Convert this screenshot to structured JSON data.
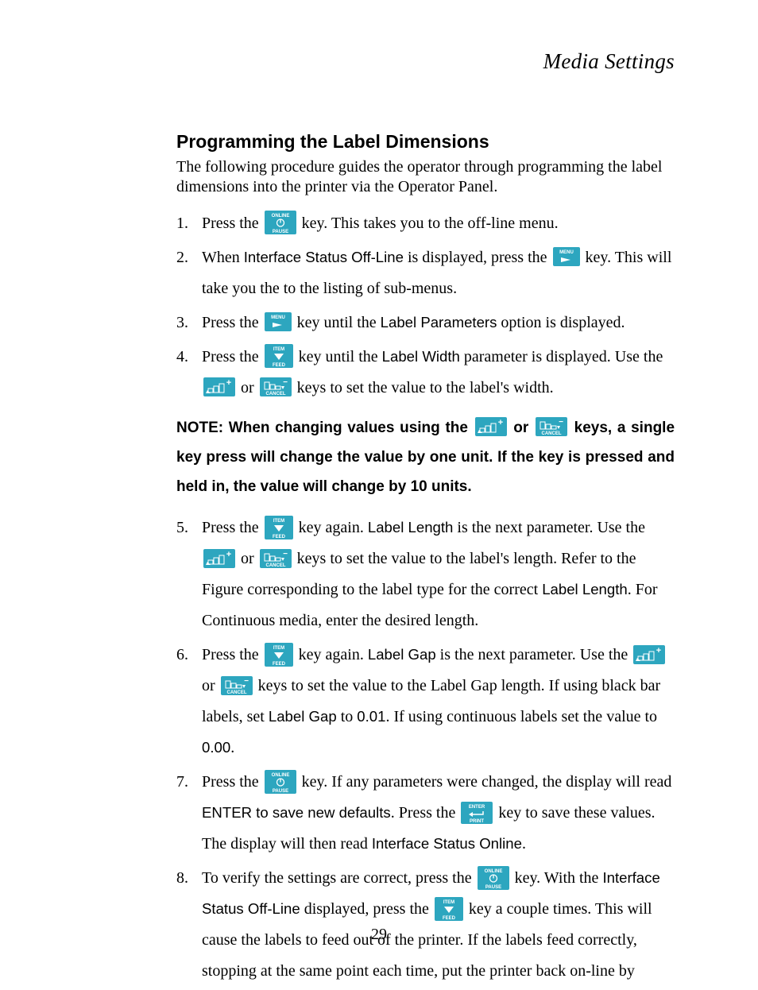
{
  "chapter": {
    "title": "Media Settings"
  },
  "section": {
    "heading": "Programming the Label Dimensions",
    "intro": "The following procedure guides the operator through programming the label dimensions into the printer via the Operator Panel."
  },
  "steps": {
    "s1a": "Press the ",
    "s1b": " key. This takes you to the off-line menu.",
    "s2a": "When ",
    "s2b": "Interface Status Off-Line",
    "s2c": " is displayed, press the ",
    "s2d": " key. This will take you the to the listing of sub-menus.",
    "s3a": "Press the ",
    "s3b": " key until the ",
    "s3c": "Label Parameters",
    "s3d": " option is displayed.",
    "s4a": "Press the ",
    "s4b": " key until the ",
    "s4c": "Label Width",
    "s4d": " parameter is displayed. Use the ",
    "s4e": " or ",
    "s4f": " keys to set the value to the label's width.",
    "s5a": "Press the ",
    "s5b": " key again. ",
    "s5c": "Label Length",
    "s5d": " is the next parameter. Use the ",
    "s5e": " or ",
    "s5f": " keys to set the value to the label's length. Refer to the Figure corresponding to the label type for the correct ",
    "s5g": "Label Length",
    "s5h": ". For Continuous media, enter the desired length.",
    "s6a": "Press the ",
    "s6b": " key again. ",
    "s6c": "Label Gap",
    "s6d": " is the next parameter. Use the ",
    "s6e": " or ",
    "s6f": " keys to set the value to the Label Gap length. If using black bar labels, set ",
    "s6g": "Label Gap",
    "s6h": " to ",
    "s6i": "0.01",
    "s6j": ". If using continuous labels set the value to ",
    "s6k": "0.00",
    "s6l": ".",
    "s7a": "Press the ",
    "s7b": " key. If any parameters were changed, the display will read ",
    "s7c": "ENTER to save new defaults",
    "s7d": ". Press the ",
    "s7e": " key to save these values. The display will then read ",
    "s7f": "Interface Status Online",
    "s7g": ".",
    "s8a": "To verify the settings are correct, press the ",
    "s8b": " key. With the ",
    "s8c": "Interface Status Off-Line",
    "s8d": " displayed, press the ",
    "s8e": " key a couple times. This will cause the labels to feed out of the printer. If the labels feed correctly, stopping at the same point each time, put the printer back on-line by"
  },
  "note": {
    "a": "NOTE: When changing values using the ",
    "b": " or ",
    "c": " keys, a single key press will change the value by one unit. If the key is pressed and held in, the value will change by 10 units."
  },
  "icons": {
    "pause": {
      "top": "ONLINE",
      "bot": "PAUSE"
    },
    "menu": {
      "top": "MENU"
    },
    "item": {
      "top": "ITEM",
      "bot": "FEED"
    },
    "plus": {
      "sym": "+"
    },
    "minus": {
      "sym": "−",
      "bot": "CANCEL"
    },
    "enter": {
      "top": "ENTER",
      "bot": "PRINT"
    }
  },
  "page": {
    "number": "29"
  }
}
